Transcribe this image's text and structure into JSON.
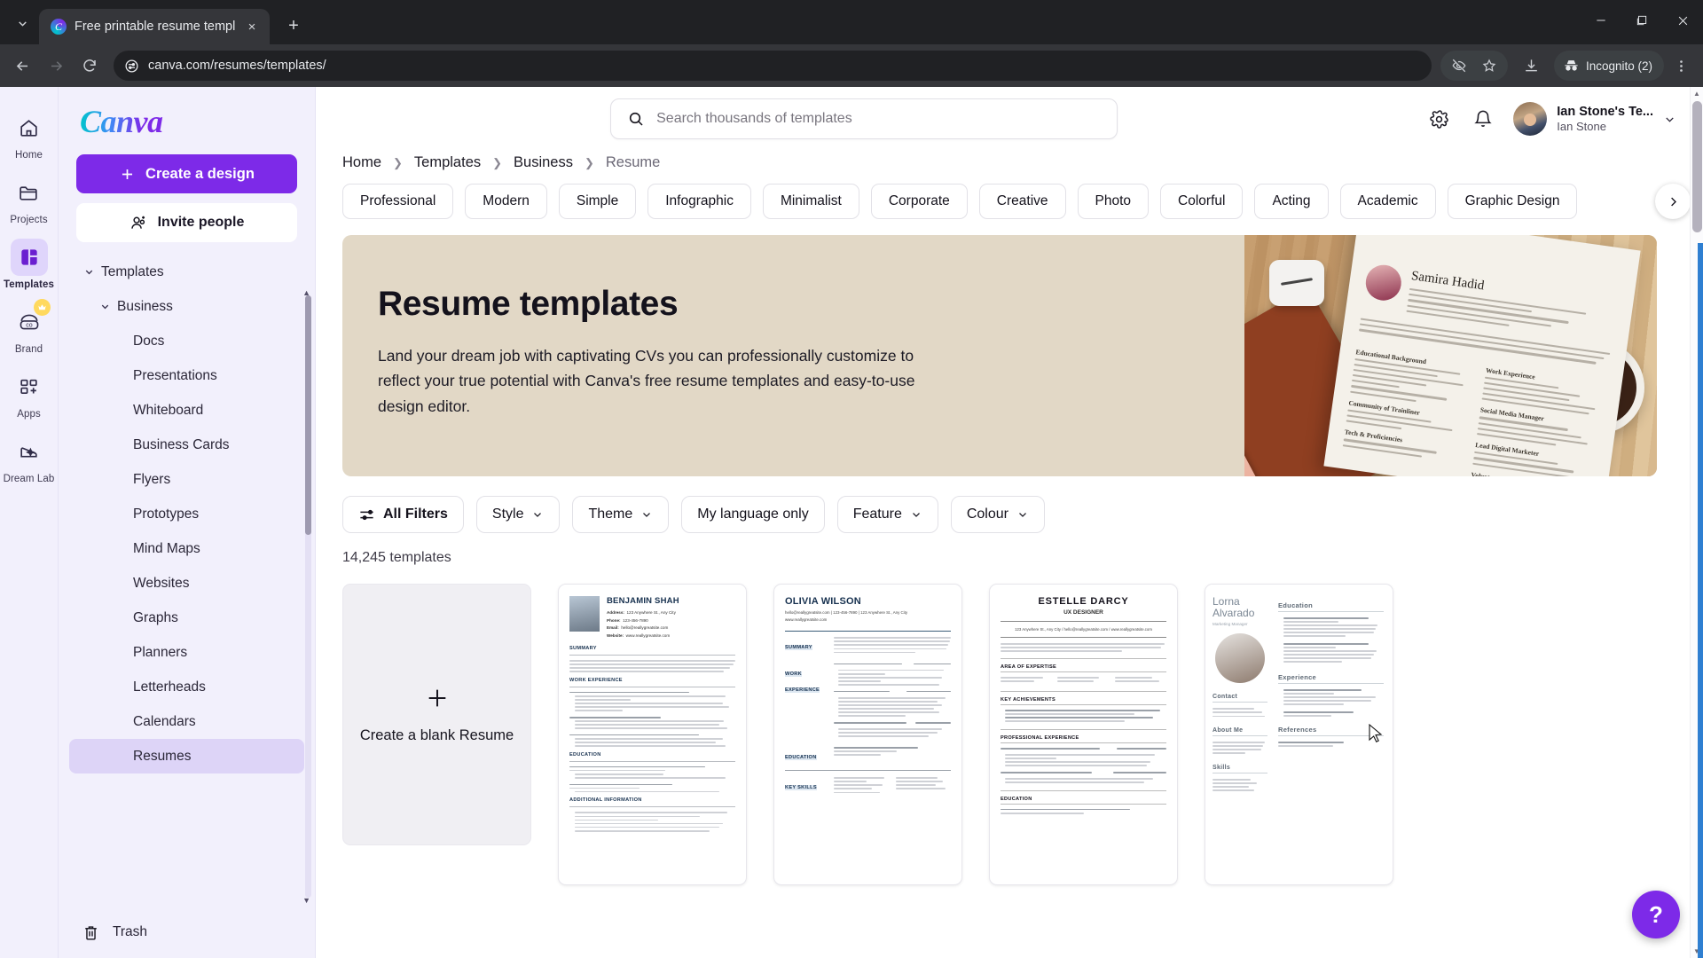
{
  "browser": {
    "tab": {
      "title": "Free printable resume template",
      "favicon": "canva-favicon",
      "close": "×"
    },
    "new_tab": "+",
    "window": {
      "minimize": "—",
      "maximize": "❐",
      "close": "✕"
    },
    "nav": {
      "back": "←",
      "forward": "→",
      "reload": "⟳"
    },
    "omnibox": {
      "site_settings_icon": "tune-icon",
      "url": "canva.com/resumes/templates/"
    },
    "actions": {
      "hide_icon": "eye-off-icon",
      "bookmark_icon": "star-icon",
      "download_icon": "download-icon",
      "profile_label": "Incognito (2)",
      "menu_icon": "kebab-menu-icon"
    }
  },
  "rail": {
    "items": [
      {
        "label": "Home",
        "icon": "home-icon",
        "active": false
      },
      {
        "label": "Projects",
        "icon": "folder-icon",
        "active": false
      },
      {
        "label": "Templates",
        "icon": "templates-icon",
        "active": true
      },
      {
        "label": "Brand",
        "icon": "brand-icon",
        "active": false,
        "badge": "crown-icon"
      },
      {
        "label": "Apps",
        "icon": "apps-grid-icon",
        "active": false
      },
      {
        "label": "Dream Lab",
        "icon": "dream-lab-icon",
        "active": false
      }
    ]
  },
  "sidebar": {
    "logo": "Canva",
    "create_button": "Create a design",
    "invite_button": "Invite people",
    "tree": [
      {
        "label": "Templates",
        "level": 0,
        "expandable": true,
        "selected": false
      },
      {
        "label": "Business",
        "level": 1,
        "expandable": true,
        "selected": false
      },
      {
        "label": "Docs",
        "level": 2,
        "expandable": false,
        "selected": false
      },
      {
        "label": "Presentations",
        "level": 2,
        "expandable": false,
        "selected": false
      },
      {
        "label": "Whiteboard",
        "level": 2,
        "expandable": false,
        "selected": false
      },
      {
        "label": "Business Cards",
        "level": 2,
        "expandable": false,
        "selected": false
      },
      {
        "label": "Flyers",
        "level": 2,
        "expandable": false,
        "selected": false
      },
      {
        "label": "Prototypes",
        "level": 2,
        "expandable": false,
        "selected": false
      },
      {
        "label": "Mind Maps",
        "level": 2,
        "expandable": false,
        "selected": false
      },
      {
        "label": "Websites",
        "level": 2,
        "expandable": false,
        "selected": false
      },
      {
        "label": "Graphs",
        "level": 2,
        "expandable": false,
        "selected": false
      },
      {
        "label": "Planners",
        "level": 2,
        "expandable": false,
        "selected": false
      },
      {
        "label": "Letterheads",
        "level": 2,
        "expandable": false,
        "selected": false
      },
      {
        "label": "Calendars",
        "level": 2,
        "expandable": false,
        "selected": false
      },
      {
        "label": "Resumes",
        "level": 2,
        "expandable": false,
        "selected": true
      }
    ],
    "trash": "Trash"
  },
  "header": {
    "search_placeholder": "Search thousands of templates",
    "search_value": "",
    "settings_icon": "gear-icon",
    "notifications_icon": "bell-icon",
    "account": {
      "team": "Ian Stone's Te...",
      "user": "Ian Stone",
      "chevron": "chevron-down-icon"
    }
  },
  "breadcrumb": {
    "items": [
      "Home",
      "Templates",
      "Business",
      "Resume"
    ],
    "separator": "❯"
  },
  "category_chips": {
    "items": [
      "Professional",
      "Modern",
      "Simple",
      "Infographic",
      "Minimalist",
      "Corporate",
      "Creative",
      "Photo",
      "Colorful",
      "Acting",
      "Academic",
      "Graphic Design"
    ],
    "next_arrow": "chevron-right-icon"
  },
  "hero": {
    "title": "Resume templates",
    "description": "Land your dream job with captivating CVs you can professionally customize to reflect your true potential with Canva's free resume templates and easy-to-use design editor.",
    "background_color": "#e2d8c6",
    "image_resume_name": "Samira Hadid"
  },
  "filters": {
    "all_filters": "All Filters",
    "all_filters_icon": "sliders-icon",
    "dropdowns": [
      {
        "label": "Style",
        "has_chevron": true
      },
      {
        "label": "Theme",
        "has_chevron": true
      },
      {
        "label": "My language only",
        "has_chevron": false
      },
      {
        "label": "Feature",
        "has_chevron": true
      },
      {
        "label": "Colour",
        "has_chevron": true
      }
    ],
    "result_count": "14,245 templates"
  },
  "grid": {
    "blank_card": {
      "label": "Create a blank Resume",
      "icon": "plus-icon"
    },
    "templates": [
      {
        "name": "BENJAMIN SHAH",
        "style": "photo-left-classic"
      },
      {
        "name": "OLIVIA WILSON",
        "style": "two-column-blue"
      },
      {
        "name": "ESTELLE DARCY",
        "role": "UX DESIGNER",
        "style": "centered-serif"
      },
      {
        "name": "Lorna Alvarado",
        "role": "Marketing Manager",
        "style": "photo-sidebar"
      }
    ],
    "template_details": {
      "benjamin": {
        "fields": [
          "Address:",
          "Phone:",
          "Email:",
          "Website:"
        ],
        "sections": [
          "SUMMARY",
          "WORK EXPERIENCE",
          "EDUCATION",
          "ADDITIONAL INFORMATION"
        ]
      },
      "olivia": {
        "sections": [
          "SUMMARY",
          "WORK EXPERIENCE",
          "EDUCATION",
          "KEY SKILLS"
        ]
      },
      "estelle": {
        "sections": [
          "AREA OF EXPERTISE",
          "KEY ACHIEVEMENTS",
          "PROFESSIONAL EXPERIENCE",
          "EDUCATION"
        ]
      },
      "lorna": {
        "sections": [
          "Education",
          "Contact",
          "About Me",
          "Experience",
          "Skills",
          "References"
        ]
      }
    }
  },
  "help_button": {
    "label": "?",
    "color": "#7d2ae8"
  }
}
